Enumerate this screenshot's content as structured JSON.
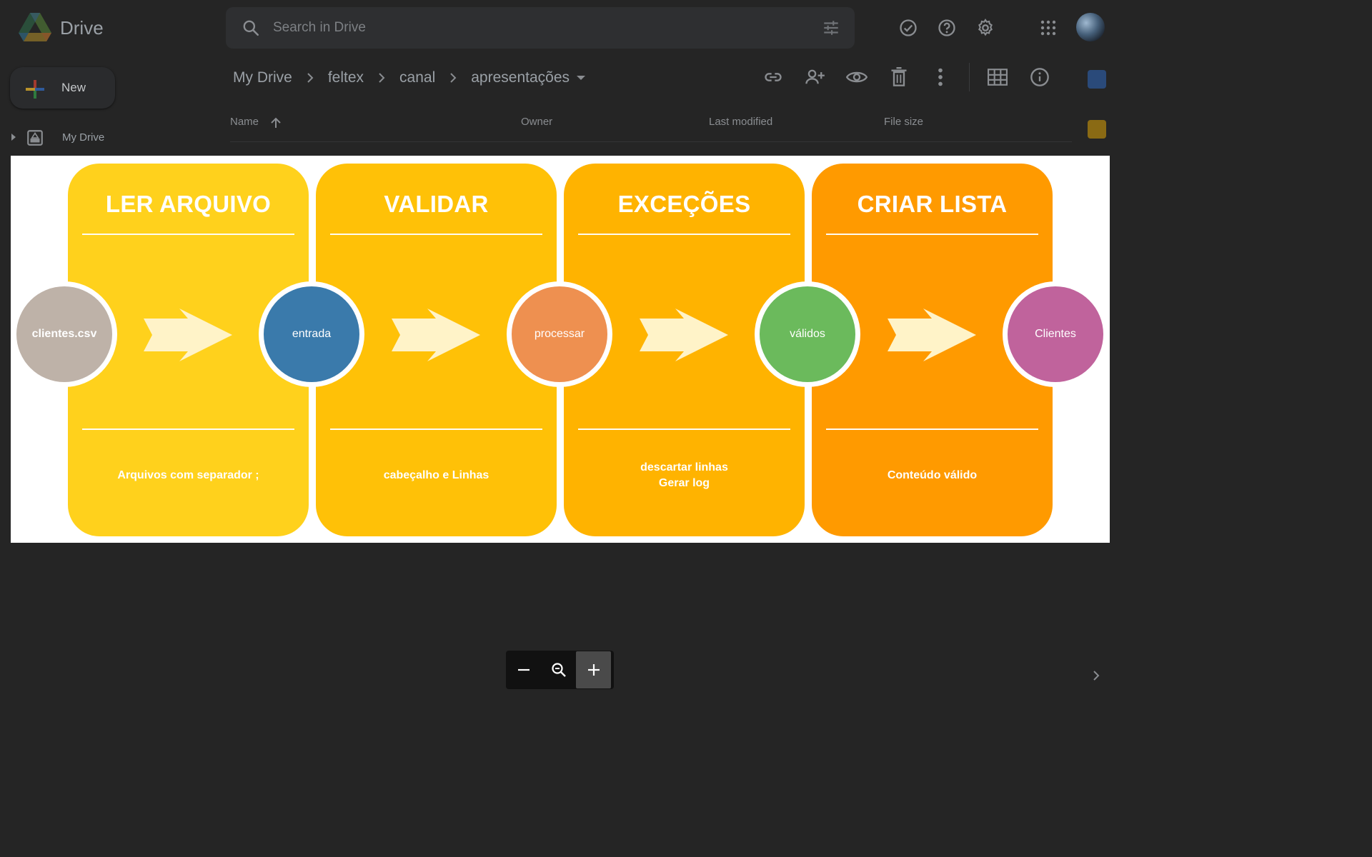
{
  "app": {
    "name": "Drive",
    "search_placeholder": "Search in Drive"
  },
  "sidebar": {
    "new_label": "New",
    "items": [
      {
        "label": "My Drive"
      }
    ]
  },
  "breadcrumb": [
    "My Drive",
    "feltex",
    "canal",
    "apresentações"
  ],
  "columns": [
    "Name",
    "Owner",
    "Last modified",
    "File size"
  ],
  "icons": {
    "top": [
      "offline-ready-icon",
      "help-icon",
      "settings-icon",
      "apps-grid-icon"
    ],
    "toolbar": [
      "link-icon",
      "share-icon",
      "preview-icon",
      "trash-icon",
      "more-vert-icon",
      "grid-view-icon",
      "info-icon"
    ],
    "zoom": [
      "zoom-out-icon",
      "zoom-reset-icon",
      "zoom-in-icon"
    ]
  },
  "preview": {
    "panels": [
      {
        "title": "LER ARQUIVO",
        "desc": "Arquivos com separador ;",
        "color": "#FFD11C"
      },
      {
        "title": "VALIDAR",
        "desc": "cabeçalho  e  Linhas",
        "color": "#FFC107"
      },
      {
        "title": "EXCEÇÕES",
        "desc": "descartar linhas\nGerar log",
        "color": "#FFB300"
      },
      {
        "title": "CRIAR LISTA",
        "desc": "Conteúdo válido",
        "color": "#FF9A00"
      }
    ],
    "nodes": [
      {
        "label": "clientes.csv",
        "color": "#BEB2A8"
      },
      {
        "label": "entrada",
        "color": "#3A7AAB"
      },
      {
        "label": "processar",
        "color": "#EE9050"
      },
      {
        "label": "válidos",
        "color": "#6BBA5C"
      },
      {
        "label": "Clientes",
        "color": "#C0639C"
      }
    ],
    "arrow_color": "#FFF3C8"
  },
  "colors": {
    "background": "#252525",
    "zoom_bar": "#111111"
  }
}
